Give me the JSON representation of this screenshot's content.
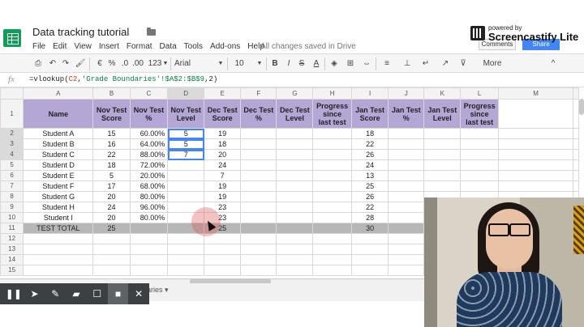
{
  "doc": {
    "title": "Data tracking tutorial",
    "save_status": "All changes saved in Drive"
  },
  "menu": [
    "File",
    "Edit",
    "View",
    "Insert",
    "Format",
    "Data",
    "Tools",
    "Add-ons",
    "Help"
  ],
  "watermark": {
    "small": "powered by",
    "big": "Screencastify Lite"
  },
  "header_buttons": {
    "comments": "Comments",
    "share": "Share"
  },
  "toolbar": {
    "currency": "€",
    "percent": "%",
    "decimals_down": ".0",
    "decimals_up": ".00",
    "format": "123",
    "font": "Arial",
    "font_size": "10",
    "bold": "B",
    "italic": "I",
    "strike": "S",
    "text_color": "A",
    "more": "More",
    "collapse": "^"
  },
  "formula_bar": {
    "fx": "fx",
    "prefix": "=vlookup(",
    "ref": "C2",
    "mid": ",",
    "string": "'Grade Boundaries'!$A$2:$B$9",
    "suffix": ",2)"
  },
  "columns": [
    "A",
    "B",
    "C",
    "D",
    "E",
    "F",
    "G",
    "H",
    "I",
    "J",
    "K",
    "L",
    "M"
  ],
  "header_row": [
    "Name",
    "Nov Test Score",
    "Nov Test %",
    "Nov Test Level",
    "Dec Test Score",
    "Dec Test %",
    "Dec Test Level",
    "Progress since last test",
    "Jan Test Score",
    "Jan Test %",
    "Jan Test Level",
    "Progress since last test",
    ""
  ],
  "rows": [
    {
      "n": "2",
      "cells": [
        "Student A",
        "15",
        "60.00%",
        "5",
        "19",
        "",
        "",
        "",
        "18",
        "",
        "",
        "",
        ""
      ]
    },
    {
      "n": "3",
      "cells": [
        "Student B",
        "16",
        "64.00%",
        "5",
        "18",
        "",
        "",
        "",
        "22",
        "",
        "",
        "",
        ""
      ]
    },
    {
      "n": "4",
      "cells": [
        "Student C",
        "22",
        "88.00%",
        "7",
        "20",
        "",
        "",
        "",
        "26",
        "",
        "",
        "",
        ""
      ]
    },
    {
      "n": "5",
      "cells": [
        "Student D",
        "18",
        "72.00%",
        "",
        "24",
        "",
        "",
        "",
        "24",
        "",
        "",
        "",
        ""
      ]
    },
    {
      "n": "6",
      "cells": [
        "Student E",
        "5",
        "20.00%",
        "",
        "7",
        "",
        "",
        "",
        "13",
        "",
        "",
        "",
        ""
      ]
    },
    {
      "n": "7",
      "cells": [
        "Student F",
        "17",
        "68.00%",
        "",
        "19",
        "",
        "",
        "",
        "25",
        "",
        "",
        "",
        ""
      ]
    },
    {
      "n": "8",
      "cells": [
        "Student G",
        "20",
        "80.00%",
        "",
        "19",
        "",
        "",
        "",
        "26",
        "",
        "",
        "",
        ""
      ]
    },
    {
      "n": "9",
      "cells": [
        "Student H",
        "24",
        "96.00%",
        "",
        "23",
        "",
        "",
        "",
        "22",
        "",
        "",
        "",
        ""
      ]
    },
    {
      "n": "10",
      "cells": [
        "Student I",
        "20",
        "80.00%",
        "",
        "23",
        "",
        "",
        "",
        "28",
        "",
        "",
        "",
        ""
      ]
    },
    {
      "n": "11",
      "total": true,
      "cells": [
        "TEST TOTAL",
        "25",
        "",
        "",
        "25",
        "",
        "",
        "",
        "30",
        "",
        "",
        "",
        ""
      ]
    },
    {
      "n": "12",
      "cells": [
        "",
        "",
        "",
        "",
        "",
        "",
        "",
        "",
        "",
        "",
        "",
        "",
        ""
      ]
    },
    {
      "n": "13",
      "cells": [
        "",
        "",
        "",
        "",
        "",
        "",
        "",
        "",
        "",
        "",
        "",
        "",
        ""
      ]
    },
    {
      "n": "14",
      "cells": [
        "",
        "",
        "",
        "",
        "",
        "",
        "",
        "",
        "",
        "",
        "",
        "",
        ""
      ]
    },
    {
      "n": "15",
      "cells": [
        "",
        "",
        "",
        "",
        "",
        "",
        "",
        "",
        "",
        "",
        "",
        "",
        ""
      ]
    }
  ],
  "sheet_tab": "ndaries",
  "sheet_tab_caret": "▾",
  "recorder": [
    "❚❚",
    "➤",
    "✎",
    "▰",
    "☐",
    "■",
    "✕"
  ],
  "colors": {
    "header_fill": "#b4a7d6",
    "total_fill": "#b7b7b7",
    "selection": "#4285f4",
    "brand": "#0f9d58"
  }
}
